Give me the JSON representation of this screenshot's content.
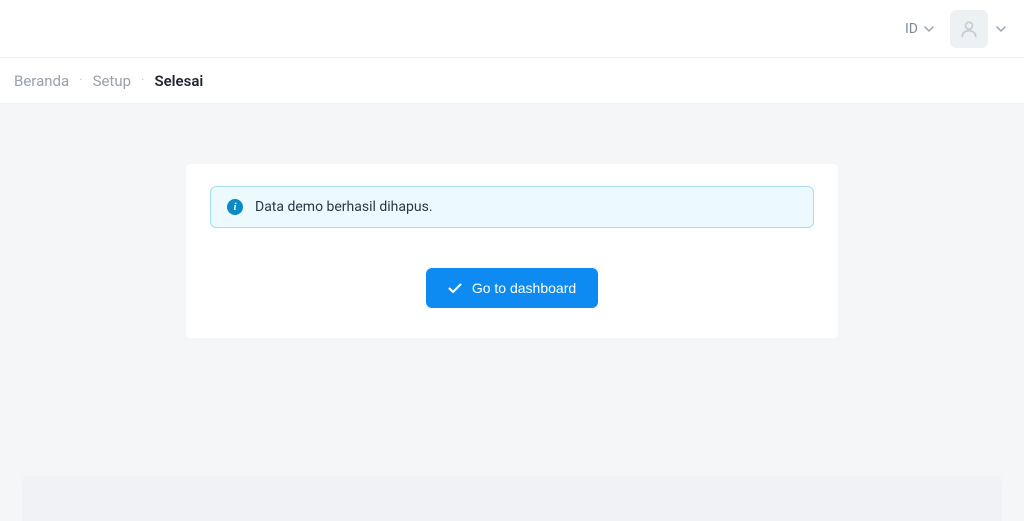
{
  "header": {
    "language": "ID"
  },
  "breadcrumb": {
    "items": [
      {
        "label": "Beranda"
      },
      {
        "label": "Setup"
      }
    ],
    "current": "Selesai"
  },
  "alert": {
    "message": "Data demo berhasil dihapus."
  },
  "actions": {
    "dashboard_btn": "Go to dashboard"
  }
}
